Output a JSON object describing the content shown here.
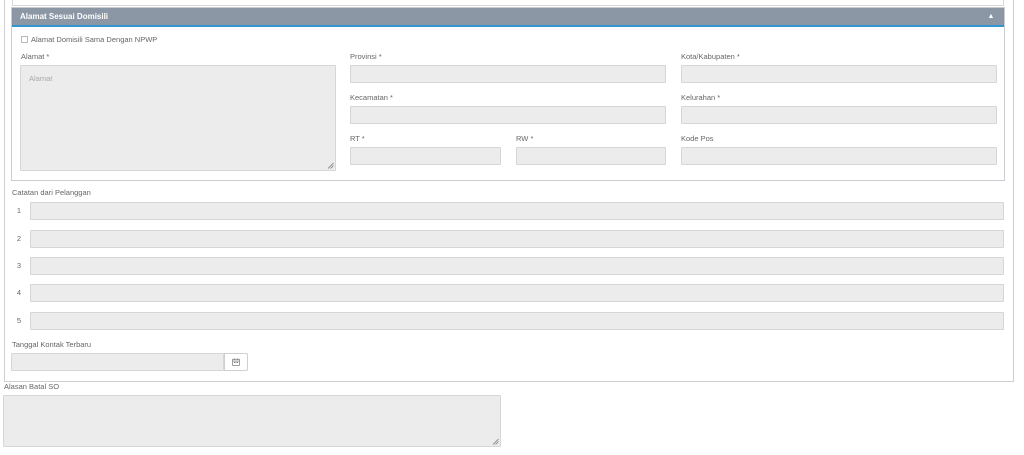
{
  "domicile_panel": {
    "title": "Alamat Sesuai Domisili",
    "collapse_icon": "chevron-up-icon",
    "same_as_npwp_label": "Alamat Domisili Sama Dengan NPWP",
    "address_label": "Alamat *",
    "address_placeholder": "Alamat",
    "province_label": "Provinsi *",
    "city_label": "Kota/Kabupaten *",
    "district_label": "Kecamatan *",
    "subdistrict_label": "Kelurahan *",
    "rt_label": "RT *",
    "rw_label": "RW *",
    "postal_code_label": "Kode Pos"
  },
  "customer_notes": {
    "label": "Catatan dari Pelanggan",
    "rows": [
      {
        "number": "1",
        "value": ""
      },
      {
        "number": "2",
        "value": ""
      },
      {
        "number": "3",
        "value": ""
      },
      {
        "number": "4",
        "value": ""
      },
      {
        "number": "5",
        "value": ""
      }
    ]
  },
  "last_contact": {
    "label": "Tanggal Kontak Terbaru",
    "value": "",
    "calendar_icon": "calendar-icon"
  },
  "cancel_reason": {
    "label": "Alasan Batal SO",
    "value": ""
  },
  "colors": {
    "panel_header_bg": "#8c97a6",
    "panel_header_accent": "#2f96d4",
    "field_bg": "#ececec"
  }
}
